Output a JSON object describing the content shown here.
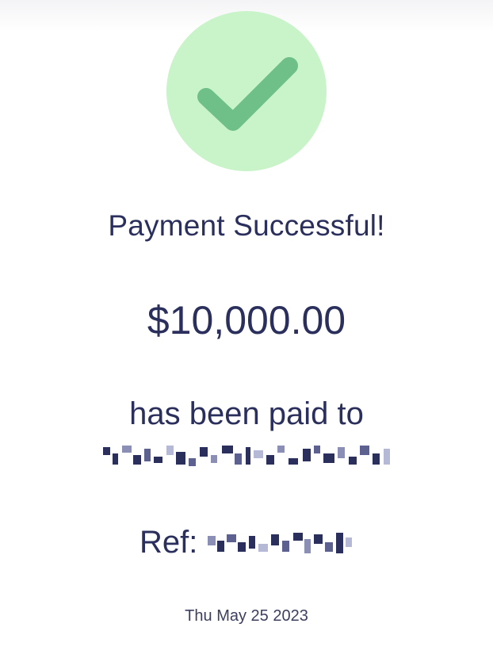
{
  "status": {
    "icon": "check-icon",
    "title": "Payment Successful!"
  },
  "payment": {
    "amount": "$10,000.00",
    "paid_to_label": "has been paid to",
    "ref_label": "Ref:",
    "date": "Thu May 25 2023"
  },
  "colors": {
    "accent_circle": "#c9f3c8",
    "check": "#6fbf89",
    "text": "#2b2f5c"
  }
}
